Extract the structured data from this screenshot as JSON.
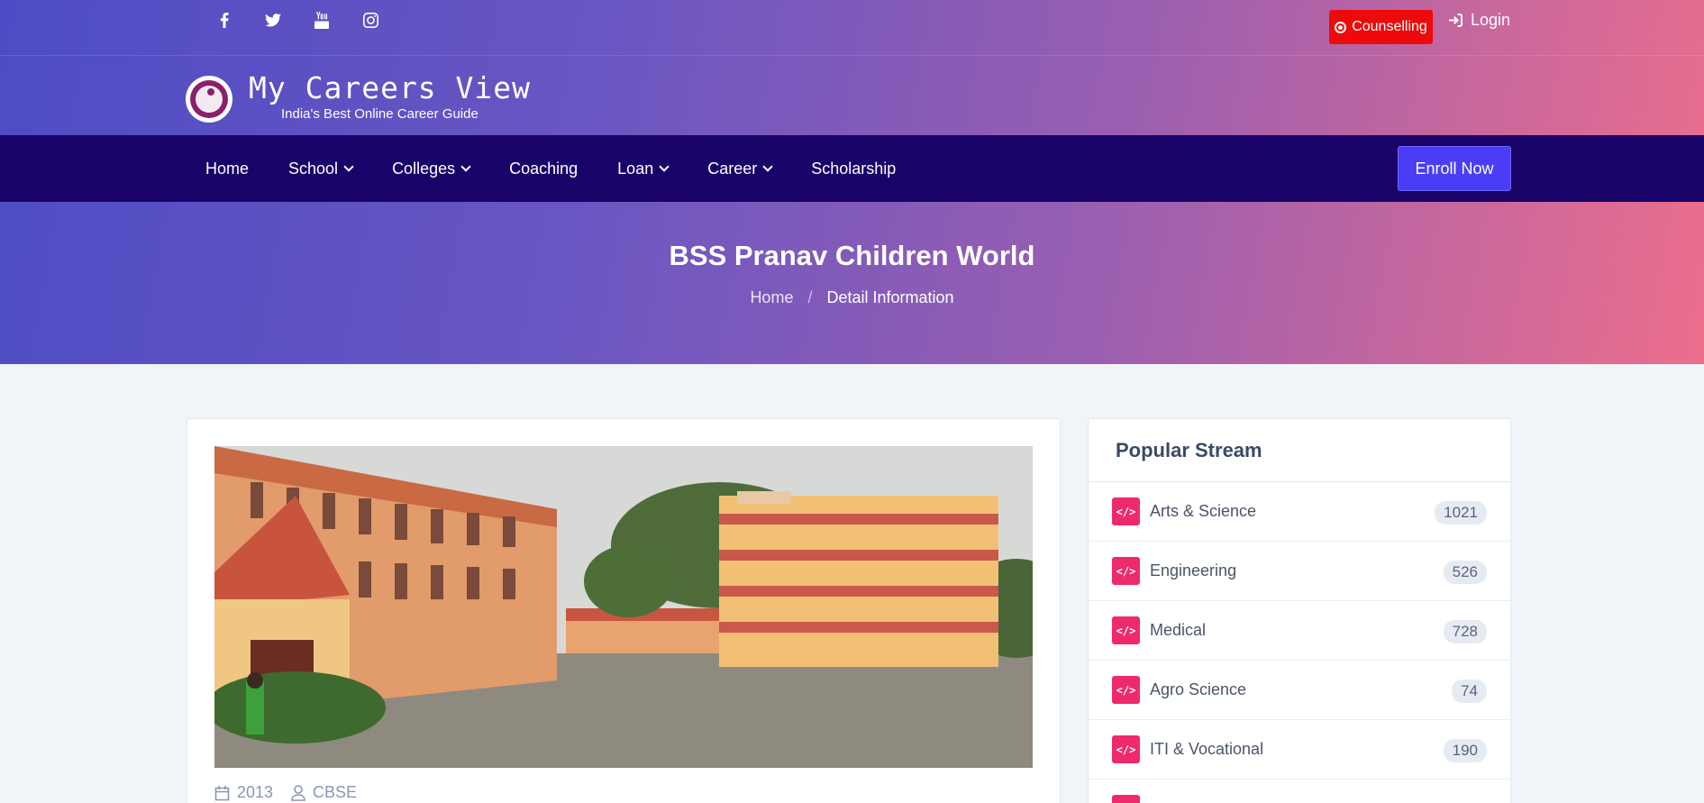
{
  "social": [
    "facebook-icon",
    "twitter-icon",
    "youtube-icon",
    "instagram-icon"
  ],
  "top": {
    "counselling": "Counselling",
    "login": "Login"
  },
  "brand": {
    "title": "My Careers View",
    "subtitle": "India's Best Online Career Guide"
  },
  "nav": {
    "items": [
      {
        "label": "Home",
        "dropdown": false
      },
      {
        "label": "School",
        "dropdown": true
      },
      {
        "label": "Colleges",
        "dropdown": true
      },
      {
        "label": "Coaching",
        "dropdown": false
      },
      {
        "label": "Loan",
        "dropdown": true
      },
      {
        "label": "Career",
        "dropdown": true
      },
      {
        "label": "Scholarship",
        "dropdown": false
      }
    ],
    "enroll": "Enroll Now"
  },
  "hero": {
    "title": "BSS Pranav Children World",
    "breadcrumb_home": "Home",
    "breadcrumb_sep": "/",
    "breadcrumb_current": "Detail Information"
  },
  "detail": {
    "year": "2013",
    "board": "CBSE"
  },
  "sidebar": {
    "title": "Popular Stream",
    "streams": [
      {
        "name": "Arts & Science",
        "count": "1021"
      },
      {
        "name": "Engineering",
        "count": "526"
      },
      {
        "name": "Medical",
        "count": "728"
      },
      {
        "name": "Agro Science",
        "count": "74"
      },
      {
        "name": "ITI & Vocational",
        "count": "190"
      }
    ]
  },
  "colors": {
    "accent": "#4a3df5",
    "navbar": "#190369",
    "counselling": "#ee0a0a",
    "stream_icon": "#ee2a6b"
  }
}
